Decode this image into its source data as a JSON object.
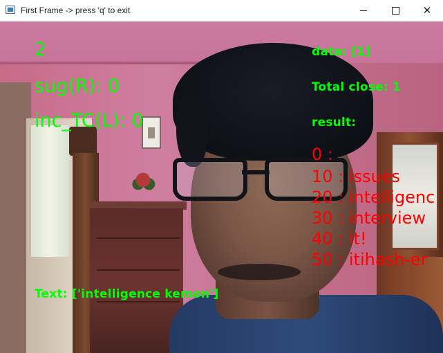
{
  "window": {
    "title": "First Frame -> press 'q' to exit",
    "icon": "opencv-window-icon",
    "controls": {
      "minimize_icon": "minimize-icon",
      "maximize_icon": "maximize-icon",
      "close_icon": "close-icon",
      "close_glyph": "✕"
    }
  },
  "overlay": {
    "count": "2",
    "sug_r": "sug(R): 0",
    "inc_tc_l": "inc_TC(L): 0",
    "data": "data: [1]",
    "total_close": "Total close: 1",
    "result_label": "result:",
    "results": [
      "0 :",
      "10 : issues",
      "20 : intelligenc",
      "30 : interview",
      "40 : it!",
      "50 : itihash-er"
    ],
    "text_line": "Text: ['intelligence kemon']"
  },
  "colors": {
    "overlay_green": "#00ff00",
    "overlay_red": "#ff0000"
  }
}
